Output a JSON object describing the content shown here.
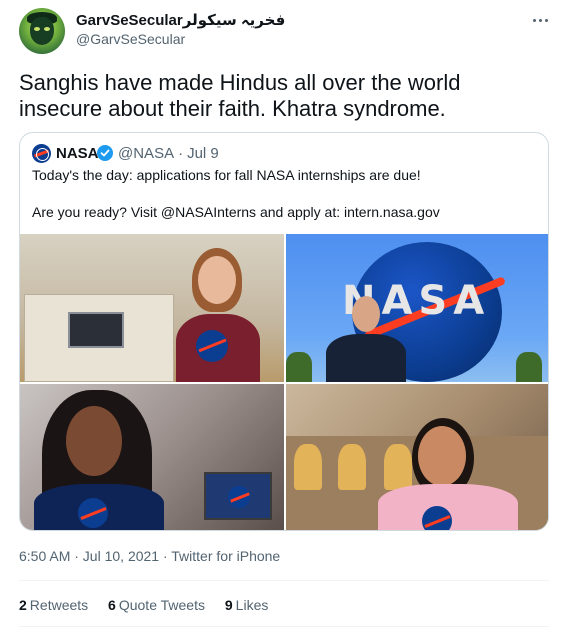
{
  "tweet": {
    "display_name": "GarvSeSecular",
    "display_name_urdu": "فخریہ سیکولر",
    "handle": "@GarvSeSecular",
    "text": "Sanghis have made Hindus all over the world insecure about their faith.  Khatra syndrome.",
    "more_icon": "more-horizontal-icon"
  },
  "quoted_tweet": {
    "name": "NASA",
    "verified_icon": "verified-badge-icon",
    "handle": "@NASA",
    "separator": "·",
    "date": "Jul 9",
    "line1": "Today's the day: applications for fall NASA internships are due!",
    "line2": "Are you ready? Visit @NASAInterns and apply at: intern.nasa.gov",
    "photos": [
      "photo-1",
      "photo-2",
      "photo-3",
      "photo-4"
    ],
    "globe_text": "NASA"
  },
  "footer": {
    "timestamp": "6:50 AM · Jul 10, 2021 · Twitter for iPhone",
    "retweets_count": "2",
    "retweets_label": "Retweets",
    "quotes_count": "6",
    "quotes_label": "Quote Tweets",
    "likes_count": "9",
    "likes_label": "Likes"
  },
  "colors": {
    "text": "#0f1419",
    "secondary": "#536471",
    "border": "#cfd9de",
    "verified": "#1d9bf0",
    "nasa_blue": "#0b3d91",
    "nasa_red": "#fc3d21"
  }
}
